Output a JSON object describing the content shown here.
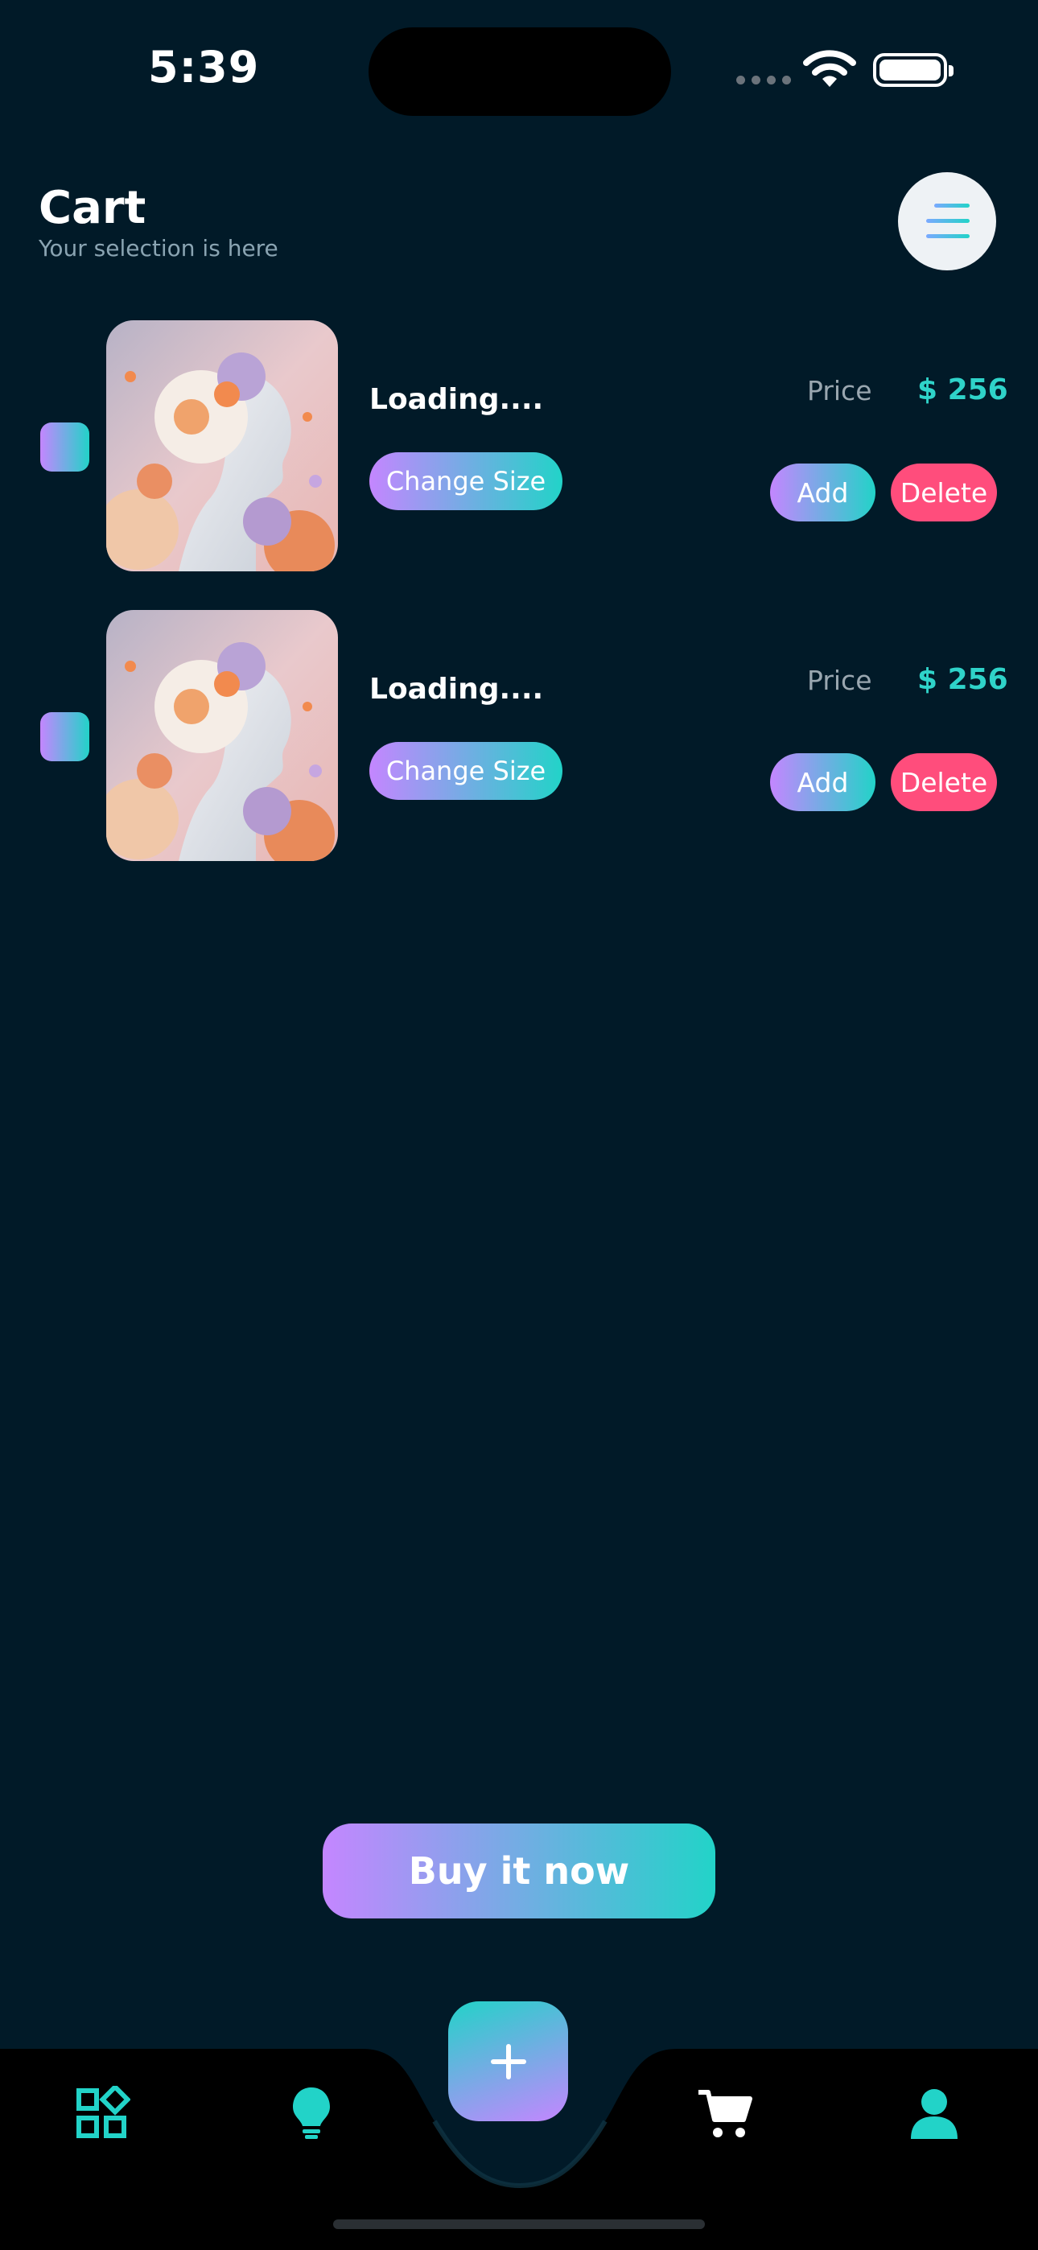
{
  "status_bar": {
    "time": "5:39"
  },
  "header": {
    "title": "Cart",
    "subtitle": "Your selection is here"
  },
  "items": [
    {
      "name": "Loading....",
      "change_size": "Change Size",
      "price_label": "Price",
      "price": "$ 256",
      "add": "Add",
      "delete": "Delete"
    },
    {
      "name": "Loading....",
      "change_size": "Change Size",
      "price_label": "Price",
      "price": "$ 256",
      "add": "Add",
      "delete": "Delete"
    }
  ],
  "buy_button": "Buy it now",
  "nav": {
    "icons": [
      "grid-icon",
      "bulb-icon",
      "plus-icon",
      "cart-icon",
      "user-icon"
    ]
  },
  "colors": {
    "background": "#011a28",
    "accent_teal": "#22d3c8",
    "accent_purple": "#c486ff",
    "delete": "#ff4d7c"
  }
}
